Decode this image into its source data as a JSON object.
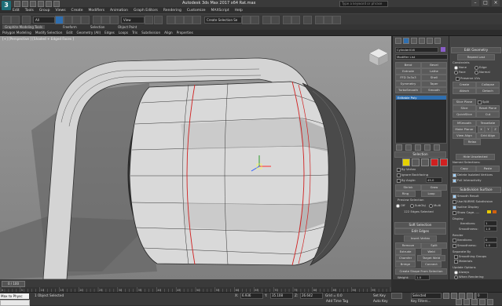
{
  "window": {
    "title": "Autodesk 3ds Max 2017 x64   Rat.max",
    "search_placeholder": "Type a keyword or phrase",
    "app_logo": "3"
  },
  "menu": [
    "Edit",
    "Tools",
    "Group",
    "Views",
    "Create",
    "Modifiers",
    "Animation",
    "Graph Editors",
    "Rendering",
    "Customize",
    "MAXScript",
    "Help"
  ],
  "toolbar": {
    "selection_filter": "All",
    "reference_coord": "View",
    "named_selection": "Create Selection Se"
  },
  "ribbon": {
    "tabs": [
      "Modeling",
      "Freeform",
      "Selection",
      "Object Paint"
    ],
    "active_tab": "Graphite Modeling Tools",
    "subtabs": [
      "Polygon Modeling",
      "Modify Selection",
      "Edit",
      "Geometry (All)",
      "Edges",
      "Loops",
      "Tris",
      "Subdivision",
      "Align",
      "Properties"
    ]
  },
  "viewport": {
    "label": "[+] [Perspective ] [Shaded + Edged Faces ]"
  },
  "modifier": {
    "object_name": "Cylinder016",
    "modifier_list": "Modifier List",
    "buttons": [
      "Bend",
      "Bevel",
      "Extrude",
      "Lathe",
      "FFD 3x3x3",
      "Shell",
      "Symmetry",
      "Taper",
      "TurboSmooth",
      "Smooth"
    ],
    "stack_item": "Editable Poly"
  },
  "selection": {
    "title": "Selection",
    "by_vertex": "By Vertex",
    "ignore_backfacing": "Ignore Backfacing",
    "by_angle": "By Angle:",
    "angle_value": "45.0",
    "shrink": "Shrink",
    "grow": "Grow",
    "ring": "Ring",
    "loop": "Loop",
    "preview_selection": "Preview Selection",
    "off": "Off",
    "subobj": "SubObj",
    "multi": "Multi",
    "selected_info": "122 Edges Selected"
  },
  "soft_selection": {
    "title": "Soft Selection"
  },
  "edit_edges": {
    "title": "Edit Edges",
    "insert_vertex": "Insert Vertex",
    "remove": "Remove",
    "split": "Split",
    "extrude": "Extrude",
    "weld": "Weld",
    "chamfer": "Chamfer",
    "target_weld": "Target Weld",
    "bridge": "Bridge",
    "connect": "Connect",
    "create_shape": "Create Shape From Selection",
    "weight_label": "Weight:",
    "weight": "1.0",
    "crease_label": "Crease:",
    "crease": "0.0"
  },
  "edit_geometry": {
    "title": "Edit Geometry",
    "repeat_last": "Repeat Last",
    "constraints": "Constraints",
    "none": "None",
    "edge": "Edge",
    "face": "Face",
    "normal": "Normal",
    "preserve_uvs": "Preserve UVs",
    "create": "Create",
    "collapse": "Collapse",
    "attach": "Attach",
    "detach": "Detach",
    "slice_plane": "Slice Plane",
    "split": "Split",
    "slice": "Slice",
    "reset_plane": "Reset Plane",
    "quickslice": "QuickSlice",
    "cut": "Cut",
    "msmooth": "MSmooth",
    "tessellate": "Tessellate",
    "make_planar": "Make Planar",
    "x": "X",
    "y": "Y",
    "z": "Z",
    "view_align": "View Align",
    "grid_align": "Grid Align",
    "relax": "Relax",
    "hide_unselected": "Hide Unselected",
    "named_selections": "Named Selections:",
    "copy": "Copy",
    "paste": "Paste",
    "delete_isolated": "Delete Isolated Vertices",
    "full_interactivity": "Full Interactivity"
  },
  "subdivision": {
    "title": "Subdivision Surface",
    "smooth_result": "Smooth Result",
    "use_nurms": "Use NURMS Subdivision",
    "isoline": "Isoline Display",
    "show_cage": "Show Cage......",
    "display": "Display",
    "iterations_label": "Iterations:",
    "iterations": "1",
    "smoothness_label": "Smoothness:",
    "smoothness": "1.0",
    "render": "Render",
    "r_iterations": "0",
    "r_smoothness": "1.0",
    "separate_by": "Separate By",
    "smoothing_groups": "Smoothing Groups",
    "materials": "Materials",
    "update_options": "Update Options",
    "always": "Always",
    "when_rendering": "When Rendering",
    "manually": "Manually"
  },
  "timeline": {
    "frame": "0 / 100",
    "ticks": [
      "0",
      "5",
      "10",
      "15",
      "20",
      "25",
      "30",
      "35",
      "40",
      "45",
      "50",
      "55",
      "60",
      "65",
      "70",
      "75",
      "80",
      "85",
      "90",
      "95",
      "100"
    ]
  },
  "status": {
    "listener": "Max to Physc",
    "object_selected": "1 Object Selected",
    "x_label": "X:",
    "x": "6.936",
    "y_label": "Y:",
    "y": "35.108",
    "z_label": "Z:",
    "z": "26.642",
    "grid": "Grid = 0.0",
    "auto_key": "Auto Key",
    "selected": "Selected",
    "set_key": "Set Key",
    "key_filters": "Key Filters...",
    "add_time_tag": "Add Time Tag",
    "frame_field": "0"
  },
  "colors": {
    "viewport_bg": "#8c8c8c",
    "mesh": "#d8d8d8",
    "red_edge": "#d02020",
    "selection_blue": "#2f6fb0"
  }
}
